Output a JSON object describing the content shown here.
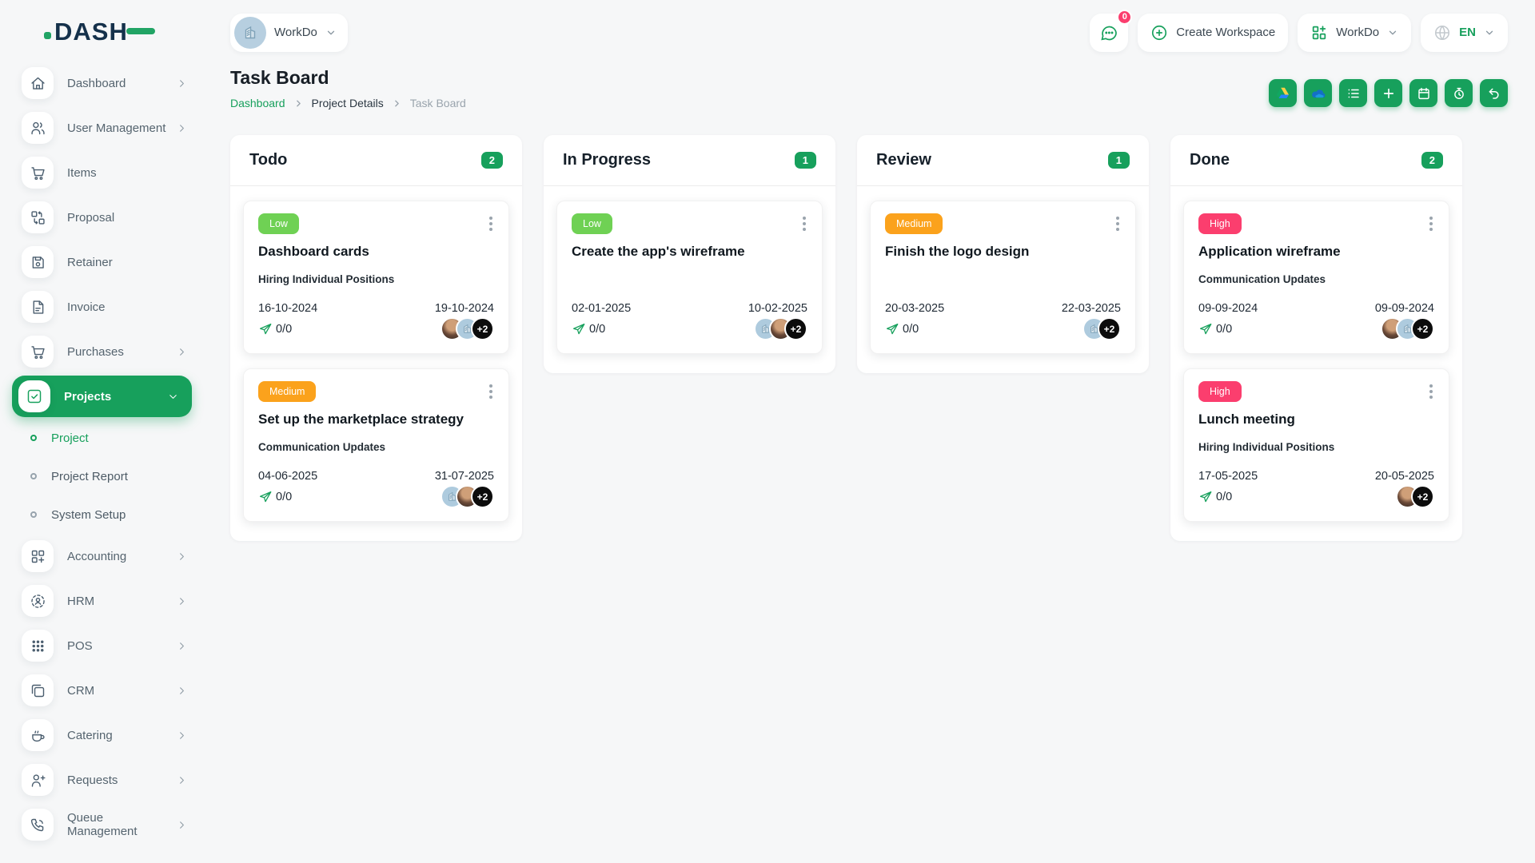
{
  "brand": {
    "name": "DASH"
  },
  "header": {
    "workspace": {
      "label": "WorkDo"
    },
    "messages": {
      "count": "0"
    },
    "create_workspace": {
      "label": "Create Workspace"
    },
    "app_menu": {
      "label": "WorkDo"
    },
    "language": {
      "label": "EN"
    }
  },
  "sidebar": {
    "items": [
      {
        "id": "dashboard",
        "label": "Dashboard",
        "icon": "home-icon",
        "expandable": true
      },
      {
        "id": "user-management",
        "label": "User Management",
        "icon": "users-icon",
        "expandable": true
      },
      {
        "id": "items",
        "label": "Items",
        "icon": "cart-icon",
        "expandable": false
      },
      {
        "id": "proposal",
        "label": "Proposal",
        "icon": "swap-boxes-icon",
        "expandable": false
      },
      {
        "id": "retainer",
        "label": "Retainer",
        "icon": "save-icon",
        "expandable": false
      },
      {
        "id": "invoice",
        "label": "Invoice",
        "icon": "file-text-icon",
        "expandable": false
      },
      {
        "id": "purchases",
        "label": "Purchases",
        "icon": "cart-icon",
        "expandable": true
      },
      {
        "id": "projects",
        "label": "Projects",
        "icon": "check-square-icon",
        "expandable": true,
        "expanded": true,
        "active": true,
        "children": [
          {
            "id": "project",
            "label": "Project",
            "active": true
          },
          {
            "id": "project-report",
            "label": "Project Report",
            "active": false
          },
          {
            "id": "system-setup",
            "label": "System Setup",
            "active": false
          }
        ]
      },
      {
        "id": "accounting",
        "label": "Accounting",
        "icon": "grid-plus-icon",
        "expandable": true
      },
      {
        "id": "hrm",
        "label": "HRM",
        "icon": "person-target-icon",
        "expandable": true
      },
      {
        "id": "pos",
        "label": "POS",
        "icon": "grid-dots-icon",
        "expandable": true
      },
      {
        "id": "crm",
        "label": "CRM",
        "icon": "frames-icon",
        "expandable": true
      },
      {
        "id": "catering",
        "label": "Catering",
        "icon": "coffee-icon",
        "expandable": true
      },
      {
        "id": "requests",
        "label": "Requests",
        "icon": "user-plus-icon",
        "expandable": true
      },
      {
        "id": "queue-management",
        "label": "Queue Management",
        "icon": "phone-call-icon",
        "expandable": true
      }
    ]
  },
  "page": {
    "title": "Task Board",
    "breadcrumb": [
      {
        "label": "Dashboard",
        "type": "link"
      },
      {
        "label": "Project Details",
        "type": "mid"
      },
      {
        "label": "Task Board",
        "type": "current"
      }
    ],
    "toolbar": [
      {
        "id": "google-drive",
        "icon": "google-drive-icon"
      },
      {
        "id": "onedrive",
        "icon": "onedrive-icon"
      },
      {
        "id": "list",
        "icon": "list-icon"
      },
      {
        "id": "add-task",
        "icon": "plus-icon"
      },
      {
        "id": "calendar",
        "icon": "calendar-icon"
      },
      {
        "id": "timer",
        "icon": "stopwatch-icon"
      },
      {
        "id": "back",
        "icon": "undo-icon"
      }
    ]
  },
  "board": {
    "columns": [
      {
        "name": "Todo",
        "count": "2",
        "cards": [
          {
            "priority": "Low",
            "priority_color": "#6FD154",
            "title": "Dashboard cards",
            "milestone": "Hiring Individual Positions",
            "start_date": "16-10-2024",
            "end_date": "19-10-2024",
            "progress": "0/0",
            "avatars": [
              "photo",
              "logo"
            ],
            "extra_count": "+2"
          },
          {
            "priority": "Medium",
            "priority_color": "#FBA21C",
            "title": "Set up the marketplace strategy",
            "milestone": "Communication Updates",
            "start_date": "04-06-2025",
            "end_date": "31-07-2025",
            "progress": "0/0",
            "avatars": [
              "logo",
              "photo"
            ],
            "extra_count": "+2"
          }
        ]
      },
      {
        "name": "In Progress",
        "count": "1",
        "cards": [
          {
            "priority": "Low",
            "priority_color": "#6FD154",
            "title": "Create the app's wireframe",
            "milestone": "",
            "start_date": "02-01-2025",
            "end_date": "10-02-2025",
            "progress": "0/0",
            "avatars": [
              "logo",
              "photo"
            ],
            "extra_count": "+2"
          }
        ]
      },
      {
        "name": "Review",
        "count": "1",
        "cards": [
          {
            "priority": "Medium",
            "priority_color": "#FBA21C",
            "title": "Finish the logo design",
            "milestone": "",
            "start_date": "20-03-2025",
            "end_date": "22-03-2025",
            "progress": "0/0",
            "avatars": [
              "logo"
            ],
            "extra_count": "+2"
          }
        ]
      },
      {
        "name": "Done",
        "count": "2",
        "cards": [
          {
            "priority": "High",
            "priority_color": "#FB3E6E",
            "title": "Application wireframe",
            "milestone": "Communication Updates",
            "start_date": "09-09-2024",
            "end_date": "09-09-2024",
            "progress": "0/0",
            "avatars": [
              "photo",
              "logo"
            ],
            "extra_count": "+2"
          },
          {
            "priority": "High",
            "priority_color": "#FB3E6E",
            "title": "Lunch meeting",
            "milestone": "Hiring Individual Positions",
            "start_date": "17-05-2025",
            "end_date": "20-05-2025",
            "progress": "0/0",
            "avatars": [
              "photo"
            ],
            "extra_count": "+2"
          }
        ]
      }
    ]
  },
  "colors": {
    "accent_green": "#17A05C",
    "priority_low": "#6FD154",
    "priority_medium": "#FBA21C",
    "priority_high": "#FB3E6E",
    "badge_red": "#FB3E6E"
  }
}
